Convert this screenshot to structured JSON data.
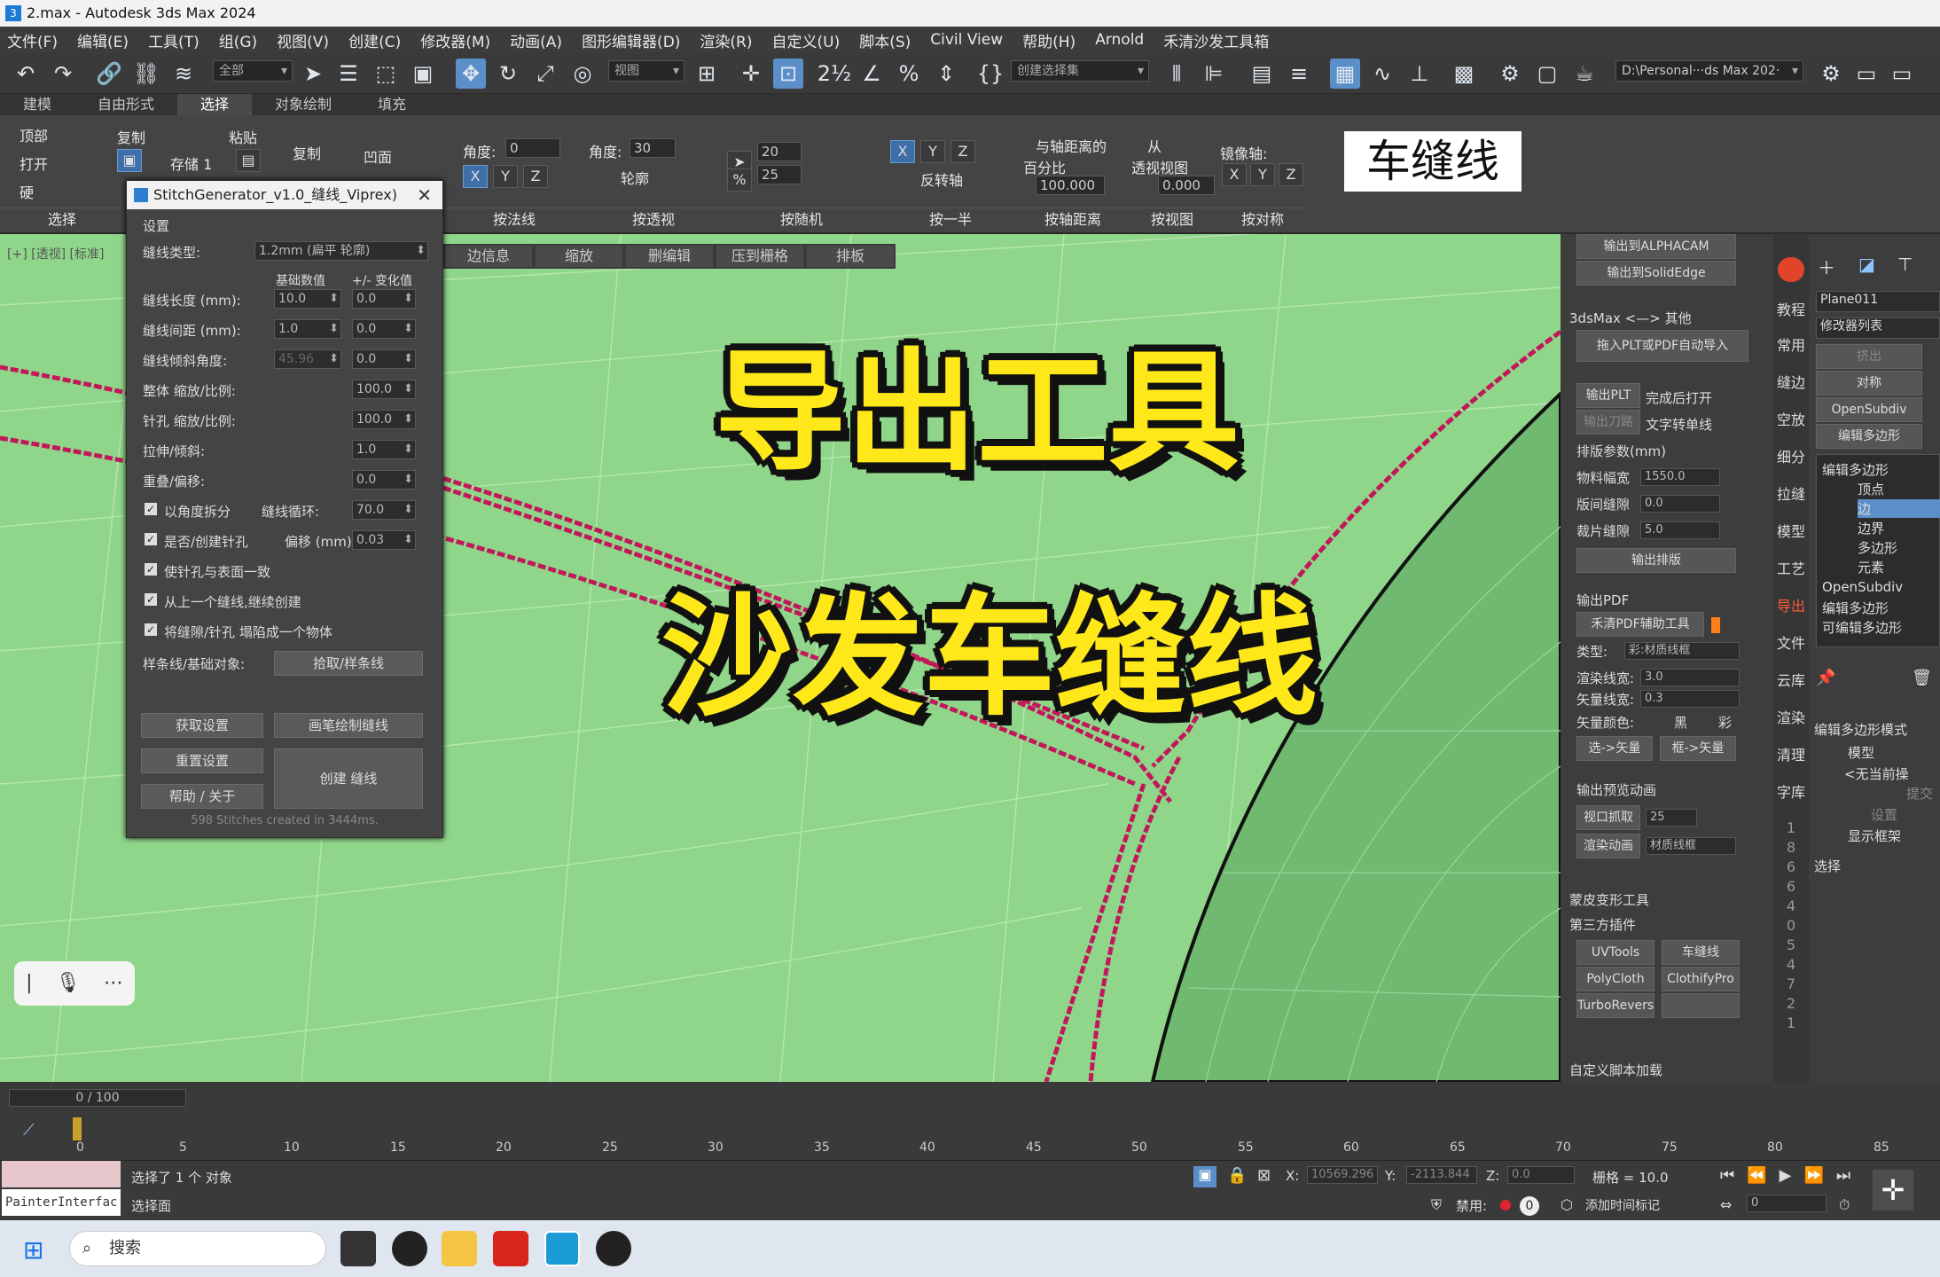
{
  "window": {
    "title": "2.max - Autodesk 3ds Max 2024",
    "app_icon": "3"
  },
  "menu": [
    "文件(F)",
    "编辑(E)",
    "工具(T)",
    "组(G)",
    "视图(V)",
    "创建(C)",
    "修改器(M)",
    "动画(A)",
    "图形编辑器(D)",
    "渲染(R)",
    "自定义(U)",
    "脚本(S)",
    "Civil View",
    "帮助(H)",
    "Arnold",
    "禾清沙发工具箱"
  ],
  "toolbar": {
    "filter_all": "全部",
    "view_ref": "视图",
    "selection_set": "创建选择集",
    "project_path": "D:\\Personal···ds Max 202·"
  },
  "ribbon_tabs": [
    "建模",
    "自由形式",
    "选择",
    "对象绘制",
    "填充"
  ],
  "ribbon": {
    "col1": [
      "顶部",
      "打开",
      "硬"
    ],
    "select_label": "选择",
    "copy": "复制",
    "paste": "粘贴",
    "store": "存储 1",
    "copy2": "复制",
    "concave": "凹面",
    "angle_label": "角度:",
    "angle_val": "0",
    "angle2_label": "角度:",
    "angle2_val": "30",
    "outline": "轮廓",
    "num20": "20",
    "num25": "25",
    "reverse_axis": "反转轴",
    "axis_dist": "与轴距离的",
    "percent": "百分比",
    "pct_val": "100.000",
    "from": "从",
    "persp": "透视视图",
    "persp_val": "0.000",
    "mirror_axis": "镜像轴:",
    "sections": [
      "按法线",
      "按透视",
      "按随机",
      "按一半",
      "按轴距离",
      "按视图",
      "按对称"
    ]
  },
  "viewport": {
    "label": "[+] [透视] [标准]",
    "tabs": [
      "边信息",
      "缩放",
      "删编辑",
      "压到栅格",
      "排板"
    ],
    "stitch_tag": "车缝线",
    "overlay_line1": "导出工具",
    "overlay_line2": "沙发车缝线"
  },
  "dialog": {
    "title": "StitchGenerator_v1.0_缝线_Viprex)",
    "settings": "设置",
    "type_label": "缝线类型:",
    "type_value": "1.2mm (扁平 轮廓)",
    "base_header": "基础数值",
    "var_header": "+/- 变化值",
    "rows": [
      {
        "label": "缝线长度 (mm):",
        "base": "10.0",
        "var": "0.0"
      },
      {
        "label": "缝线间距 (mm):",
        "base": "1.0",
        "var": "0.0"
      },
      {
        "label": "缝线倾斜角度:",
        "base": "45.96",
        "var": "0.0"
      }
    ],
    "rows2": [
      {
        "label": "整体 缩放/比例:",
        "val": "100.0"
      },
      {
        "label": "针孔 缩放/比例:",
        "val": "100.0"
      },
      {
        "label": "拉伸/倾斜:",
        "val": "1.0"
      },
      {
        "label": "重叠/偏移:",
        "val": "0.0"
      }
    ],
    "check1": "以角度拆分",
    "loop_label": "缝线循环:",
    "loop_val": "70.0",
    "check2": "是否/创建针孔",
    "offset_label": "偏移 (mm):",
    "offset_val": "0.03",
    "check3": "使针孔与表面一致",
    "check4": "从上一个缝线,继续创建",
    "check5": "将缝隙/针孔 塌陷成一个物体",
    "spline_label": "样条线/基础对象:",
    "pick_btn": "拾取/样条线",
    "get_settings": "获取设置",
    "draw_stitch": "画笔绘制缝线",
    "reset": "重置设置",
    "create": "创建 缝线",
    "help": "帮助 / 关于",
    "status": "598 Stitches created in 3444ms."
  },
  "cmdpanel": {
    "alphacam": "输出到ALPHACAM",
    "solidedge": "输出到SolidEdge",
    "max_other": "3dsMax <—> 其他",
    "import_plt": "拖入PLT或PDF自动导入",
    "export_plt": "输出PLT",
    "export_blade": "输出刀路",
    "open_after": "完成后打开",
    "text_single": "文字转单线",
    "layout_params": "排版参数(mm)",
    "mat_width": "物料幅宽",
    "mat_width_val": "1550.0",
    "gap": "版间缝隙",
    "gap_val": "0.0",
    "cut_gap": "裁片缝隙",
    "cut_gap_val": "5.0",
    "export_layout": "输出排版",
    "export_pdf": "输出PDF",
    "pdf_tool": "禾清PDF辅助工具",
    "type_label": "类型:",
    "type_val": "彩:材质线框",
    "render_width": "渲染线宽:",
    "render_width_val": "3.0",
    "vector_width": "矢量线宽:",
    "vector_width_val": "0.3",
    "vector_color": "矢量颜色:",
    "black": "黑",
    "color": "彩",
    "sel_vec": "选->矢量",
    "frame_vec": "框->矢量",
    "preview_anim": "输出预览动画",
    "viewport_grab": "视口抓取",
    "grab_val": "25",
    "render_anim": "渲染动画",
    "anim_type": "材质线框",
    "morph_tools": "蒙皮变形工具",
    "third_party": "第三方插件",
    "plugins": [
      "UVTools",
      "车缝线",
      "PolyCloth",
      "ClothifyPro",
      "TurboReverse",
      ""
    ],
    "custom_scripts": "自定义脚本加载"
  },
  "sidetabs": [
    "教程",
    "常用",
    "缝边",
    "空放",
    "细分",
    "拉缝",
    "模型",
    "工艺",
    "导出",
    "文件",
    "云库",
    "渲染",
    "清理",
    "字库"
  ],
  "sidenums": [
    "1",
    "8",
    "6",
    "6",
    "4",
    "0",
    "5",
    "4",
    "7",
    "2",
    "1"
  ],
  "modpanel": {
    "object": "Plane011",
    "mod_list": "修改器列表",
    "btns": [
      "挤出",
      "对称",
      "OpenSubdiv",
      "编辑多边形"
    ],
    "stack": [
      "编辑多边形",
      "顶点",
      "边",
      "边界",
      "多边形",
      "元素",
      "OpenSubdiv",
      "编辑多边形",
      "可编辑多边形"
    ],
    "mode_header": "编辑多边形模式",
    "model": "模型",
    "no_current": "<无当前操",
    "commit": "提交",
    "settings": "设置",
    "show_frame": "显示框架",
    "select": "选择"
  },
  "timeline": {
    "frame": "0 / 100",
    "ticks": [
      "0",
      "5",
      "10",
      "15",
      "20",
      "25",
      "30",
      "35",
      "40",
      "45",
      "50",
      "55",
      "60",
      "65",
      "70",
      "75",
      "80",
      "85"
    ]
  },
  "status": {
    "script_box": "PainterInterfac",
    "selected": "选择了 1 个 对象",
    "hint": "选择面",
    "x_label": "X:",
    "x_val": "10569.296",
    "y_label": "Y:",
    "y_val": "-2113.844",
    "z_label": "Z:",
    "z_val": "0.0",
    "grid": "栅格 = 10.0",
    "disable": "禁用:",
    "add_time": "添加时间标记",
    "frame_field": "0"
  },
  "taskbar": {
    "search": "搜索"
  },
  "colors": {
    "viewport_bg": "#8fd68a",
    "stitch": "#c2185b",
    "overlay_text": "#ffe81a",
    "accent": "#5b8fc9"
  }
}
